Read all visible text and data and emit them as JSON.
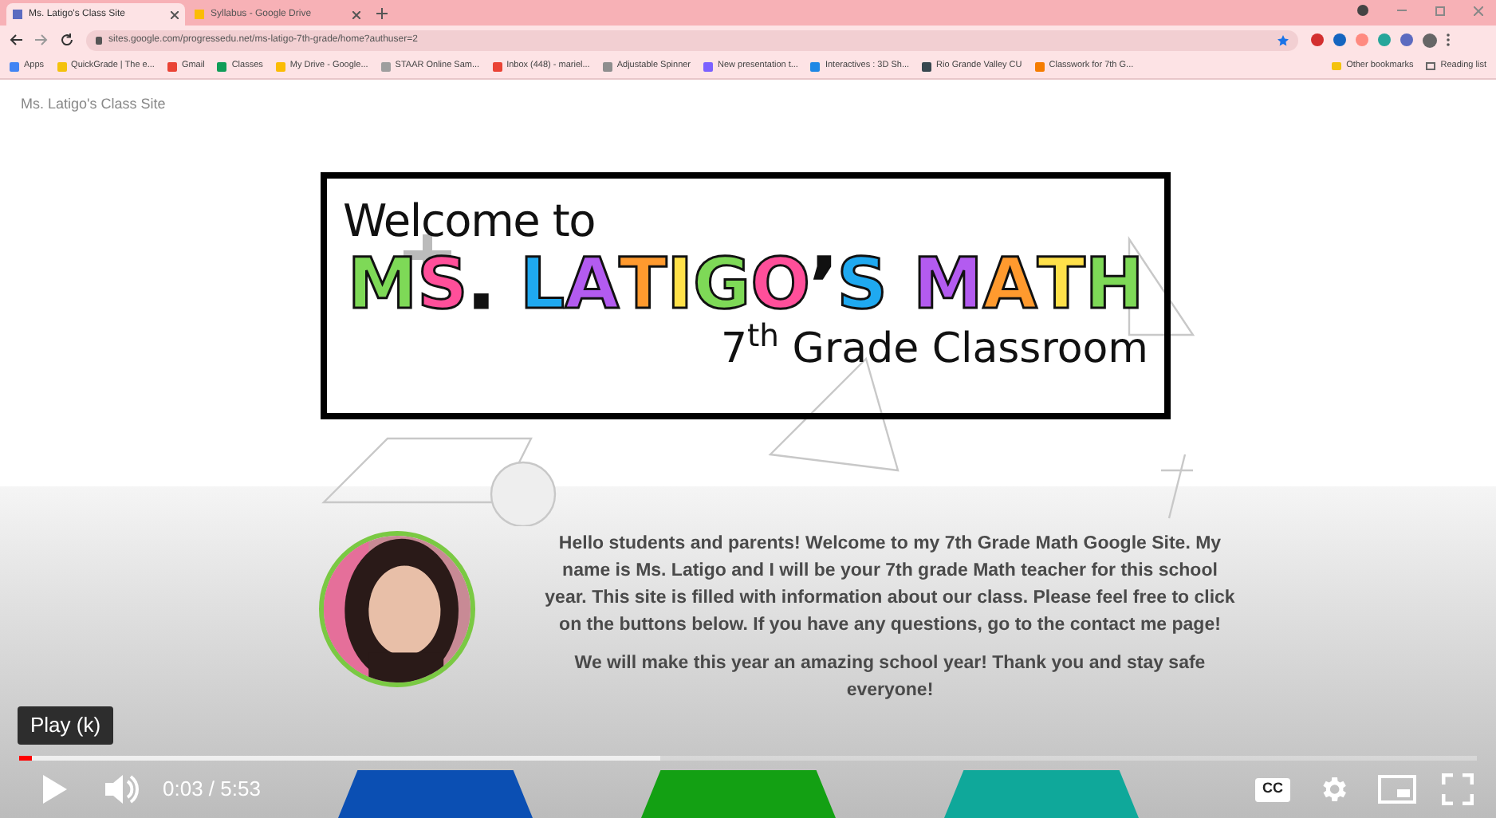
{
  "browser": {
    "tabs": [
      {
        "label": "Ms. Latigo's Class Site",
        "selected": true
      },
      {
        "label": "Syllabus - Google Drive",
        "selected": false
      }
    ],
    "url": "sites.google.com/progressedu.net/ms-latigo-7th-grade/home?authuser=2",
    "bookmarks": [
      {
        "label": "Apps",
        "color": "#4285f4"
      },
      {
        "label": "QuickGrade | The e...",
        "color": "#f4c20d"
      },
      {
        "label": "Gmail",
        "color": "#ea4335"
      },
      {
        "label": "Classes",
        "color": "#0f9d58"
      },
      {
        "label": "My Drive - Google...",
        "color": "#fbbc04"
      },
      {
        "label": "STAAR Online Sam...",
        "color": "#9e9e9e"
      },
      {
        "label": "Inbox (448) - mariel...",
        "color": "#ea4335"
      },
      {
        "label": "Adjustable Spinner",
        "color": "#8e8e8e"
      },
      {
        "label": "New presentation t...",
        "color": "#7b61ff"
      },
      {
        "label": "Interactives : 3D Sh...",
        "color": "#1e88e5"
      },
      {
        "label": "Rio Grande Valley CU",
        "color": "#37474f"
      },
      {
        "label": "Classwork for 7th G...",
        "color": "#f57c00"
      }
    ],
    "other_bookmarks": "Other bookmarks",
    "reading_list": "Reading list",
    "extensions": [
      {
        "color": "#d32f2f"
      },
      {
        "color": "#1565c0"
      },
      {
        "color": "#ff8a80"
      },
      {
        "color": "#26a69a"
      },
      {
        "color": "#5c6bc0"
      }
    ]
  },
  "site": {
    "title": "Ms. Latigo's Class Site",
    "banner": {
      "welcome": "Welcome to",
      "name_words": [
        {
          "letters": [
            {
              "text": "M",
              "color": "#7ed957"
            },
            {
              "text": "S",
              "color": "#ff4f9a"
            },
            {
              "text": ".",
              "color": "#111111"
            }
          ]
        },
        {
          "letters": [
            {
              "text": "L",
              "color": "#1fa9f0"
            },
            {
              "text": "A",
              "color": "#b35bf0"
            },
            {
              "text": "T",
              "color": "#ff9a2e"
            },
            {
              "text": "I",
              "color": "#ffe14a"
            },
            {
              "text": "G",
              "color": "#7ed957"
            },
            {
              "text": "O",
              "color": "#ff4f9a"
            },
            {
              "text": "’",
              "color": "#111111"
            },
            {
              "text": "S",
              "color": "#1fa9f0"
            }
          ]
        },
        {
          "letters": [
            {
              "text": "M",
              "color": "#b35bf0"
            },
            {
              "text": "A",
              "color": "#ff9a2e"
            },
            {
              "text": "T",
              "color": "#ffe14a"
            },
            {
              "text": "H",
              "color": "#7ed957"
            }
          ]
        }
      ],
      "subtitle": "7$^{th}$ Grade Classroom"
    },
    "paragraphs": [
      "Hello students and parents! Welcome to my 7th Grade Math Google Site. My name is Ms. Latigo and I will be your 7th grade Math teacher for this school year. This site is filled with information about our class. Please feel free to click on the buttons below. If you have any questions, go to the contact me page!",
      "We will make this year an amazing school year! Thank you and stay safe everyone!"
    ],
    "nav_buttons": [
      {
        "color": "#0b4fb3"
      },
      {
        "color": "#13a013"
      },
      {
        "color": "#0fa89a"
      }
    ]
  },
  "player": {
    "tooltip": "Play (k)",
    "progress": {
      "level": 0.0085
    },
    "time": "0:03 / 5:53",
    "cc_label": "CC"
  }
}
